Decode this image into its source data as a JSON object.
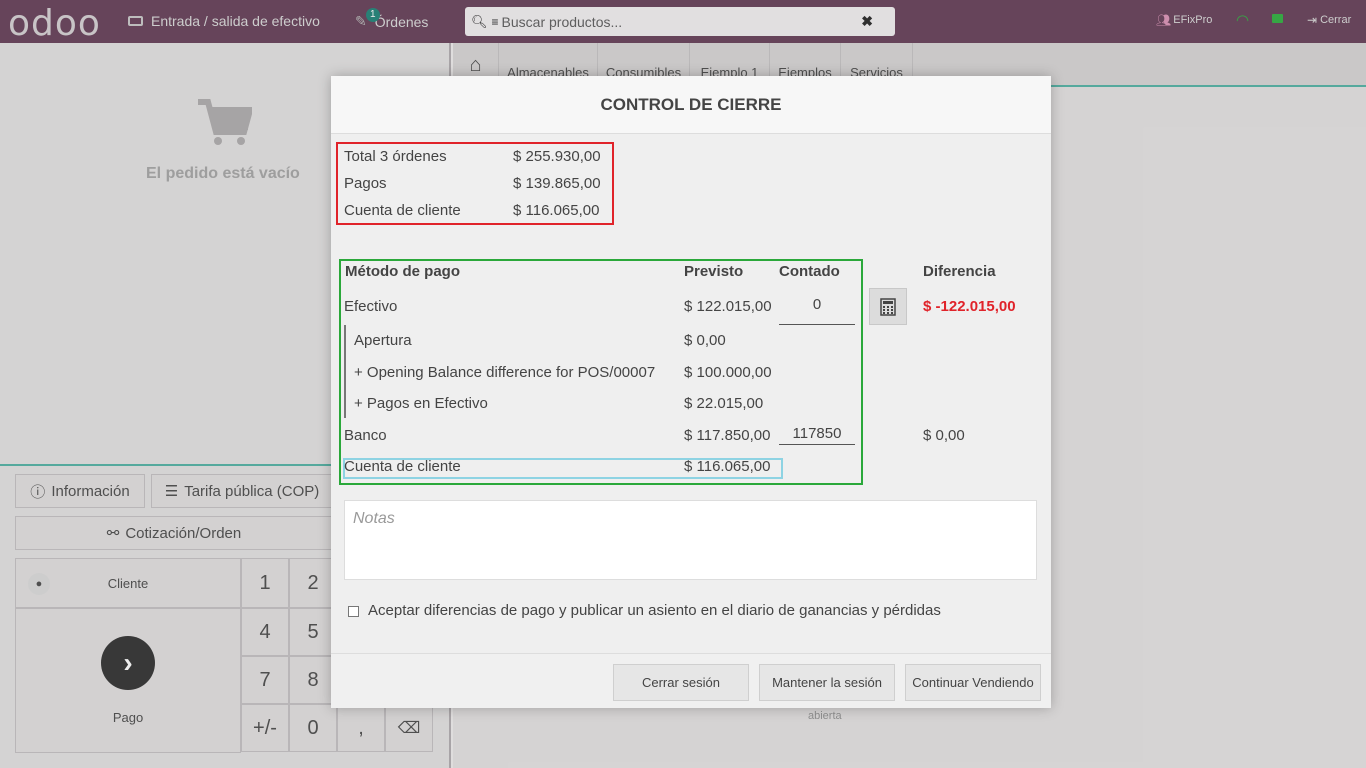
{
  "topbar": {
    "logo": "odoo",
    "cash_inout": "Entrada / salida de efectivo",
    "orders_label": "Órdenes",
    "orders_badge": "1",
    "search_placeholder": "Buscar productos...",
    "user": "EFixPro",
    "close": "Cerrar",
    "brand_color": "#6e4a61"
  },
  "left": {
    "empty_text": "El pedido está vacío",
    "info_btn": "Información",
    "pricelist_btn": "Tarifa pública (COP)",
    "quote_btn": "Cotización/Orden",
    "customer_btn": "Cliente",
    "payment_btn": "Pago",
    "keys": [
      "1",
      "2",
      "4",
      "5",
      "7",
      "8",
      "+/-",
      "0",
      ","
    ]
  },
  "categories": [
    "Almacenables",
    "Consumibles",
    "Ejemplo 1",
    "Ejemplos",
    "Servicios"
  ],
  "right_bg_text": "abierta",
  "modal": {
    "title": "CONTROL DE CIERRE",
    "summary": [
      {
        "label": "Total 3 órdenes",
        "value": "$ 255.930,00"
      },
      {
        "label": "Pagos",
        "value": "$ 139.865,00"
      },
      {
        "label": "Cuenta de cliente",
        "value": "$ 116.065,00"
      }
    ],
    "headers": {
      "method": "Método de pago",
      "expected": "Previsto",
      "counted": "Contado",
      "difference": "Diferencia"
    },
    "cash": {
      "label": "Efectivo",
      "expected": "$ 122.015,00",
      "counted": "0",
      "difference": "$ -122.015,00"
    },
    "cash_details": [
      {
        "label": "Apertura",
        "value": "$ 0,00"
      },
      {
        "label": "+ Opening Balance difference for POS/00007",
        "value": "$ 100.000,00"
      },
      {
        "label": "+ Pagos en Efectivo",
        "value": "$ 22.015,00"
      }
    ],
    "bank": {
      "label": "Banco",
      "expected": "$ 117.850,00",
      "counted": "117850",
      "difference": "$ 0,00"
    },
    "customer_account": {
      "label": "Cuenta de cliente",
      "expected": "$ 116.065,00"
    },
    "notes_placeholder": "Notas",
    "accept_label": "Aceptar diferencias de pago y publicar un asiento en el diario de ganancias y pérdidas",
    "buttons": {
      "close_session": "Cerrar sesión",
      "keep_session": "Mantener la sesión",
      "continue_selling": "Continuar Vendiendo"
    },
    "highlight_colors": {
      "summary": "#e0232a",
      "methods": "#2aa83a",
      "customer": "#8ed3e3"
    }
  }
}
